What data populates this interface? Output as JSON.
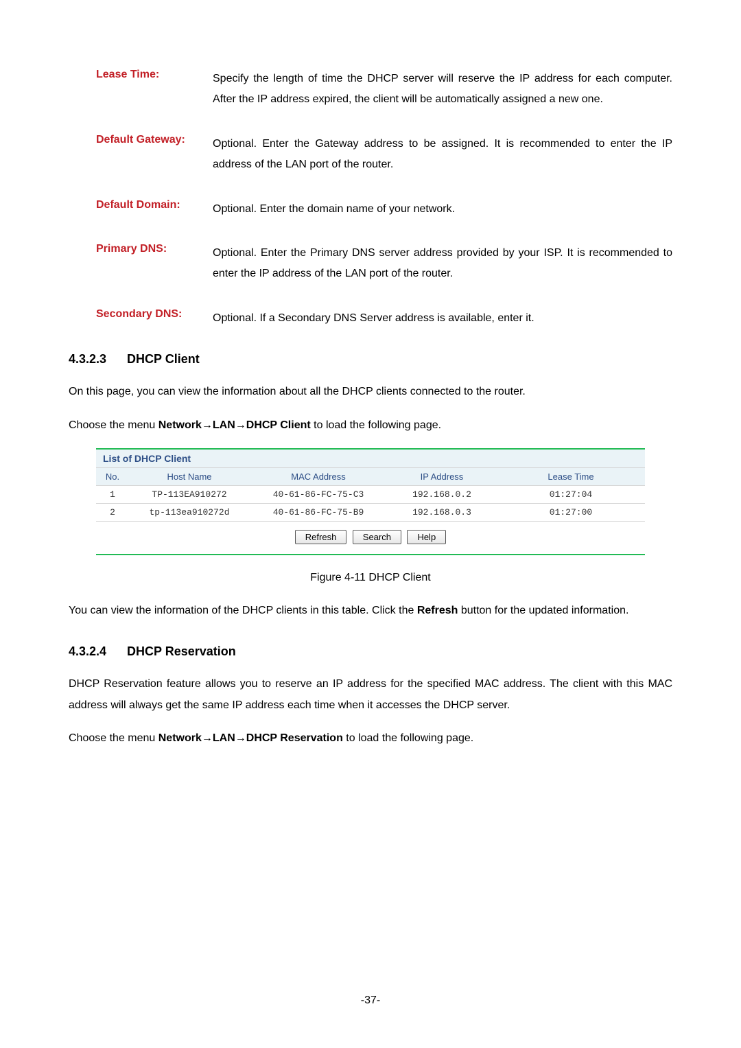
{
  "definitions": [
    {
      "term": "Lease Time:",
      "desc": "Specify the length of time the DHCP server will reserve the IP address for each computer. After the IP address expired, the client will be automatically assigned a new one."
    },
    {
      "term": "Default Gateway:",
      "desc": "Optional. Enter the Gateway address to be assigned. It is recommended to enter the IP address of the LAN port of the router."
    },
    {
      "term": "Default Domain:",
      "desc": "Optional. Enter the domain name of your network."
    },
    {
      "term": "Primary DNS:",
      "desc": "Optional. Enter the Primary DNS server address provided by your ISP. It is recommended to enter the IP address of the LAN port of the router."
    },
    {
      "term": "Secondary DNS:",
      "desc": "Optional. If a Secondary DNS Server address is available, enter it."
    }
  ],
  "section_client": {
    "num": "4.3.2.3",
    "title": "DHCP Client",
    "intro": "On this page, you can view the information about all the DHCP clients connected to the router.",
    "menu_prefix": "Choose the menu ",
    "menu_path": "Network→LAN→DHCP Client",
    "menu_suffix": " to load the following page.",
    "table_title": "List of DHCP Client",
    "headers": {
      "no": "No.",
      "host": "Host Name",
      "mac": "MAC Address",
      "ip": "IP Address",
      "lease": "Lease Time"
    },
    "rows": [
      {
        "no": "1",
        "host": "TP-113EA910272",
        "mac": "40-61-86-FC-75-C3",
        "ip": "192.168.0.2",
        "lease": "01:27:04"
      },
      {
        "no": "2",
        "host": "tp-113ea910272d",
        "mac": "40-61-86-FC-75-B9",
        "ip": "192.168.0.3",
        "lease": "01:27:00"
      }
    ],
    "buttons": {
      "refresh": "Refresh",
      "search": "Search",
      "help": "Help"
    },
    "caption": "Figure 4-11 DHCP Client",
    "outro_1": "You can view the information of the DHCP clients in this table. Click the ",
    "outro_bold": "Refresh",
    "outro_2": " button for the updated information."
  },
  "section_res": {
    "num": "4.3.2.4",
    "title": "DHCP Reservation",
    "para": "DHCP Reservation feature allows you to reserve an IP address for the specified MAC address. The client with this MAC address will always get the same IP address each time when it accesses the DHCP server.",
    "menu_prefix": "Choose the menu ",
    "menu_path": "Network→LAN→DHCP Reservation",
    "menu_suffix": " to load the following page."
  },
  "pagenum": "-37-"
}
